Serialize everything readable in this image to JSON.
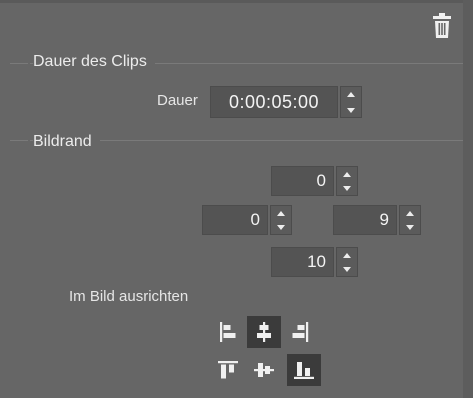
{
  "clip_duration": {
    "section_title": "Dauer des Clips",
    "duration_label": "Dauer",
    "duration_value": "0:00:05:00"
  },
  "border": {
    "section_title": "Bildrand",
    "top": "0",
    "left": "0",
    "right": "9",
    "bottom": "10"
  },
  "alignment": {
    "label": "Im Bild ausrichten",
    "horizontal": [
      {
        "name": "align-left-icon",
        "active": false
      },
      {
        "name": "align-center-horizontal-icon",
        "active": true
      },
      {
        "name": "align-right-icon",
        "active": false
      }
    ],
    "vertical": [
      {
        "name": "align-top-icon",
        "active": false
      },
      {
        "name": "align-middle-vertical-icon",
        "active": false
      },
      {
        "name": "align-bottom-icon",
        "active": true
      }
    ]
  },
  "icons": {
    "delete": "trash-icon",
    "stepper_up": "chevron-up-icon",
    "stepper_down": "chevron-down-icon"
  },
  "colors": {
    "panel_bg": "#666666",
    "field_bg": "#545454",
    "active_button_bg": "#3b3b3b",
    "text": "#f2f2f2"
  }
}
